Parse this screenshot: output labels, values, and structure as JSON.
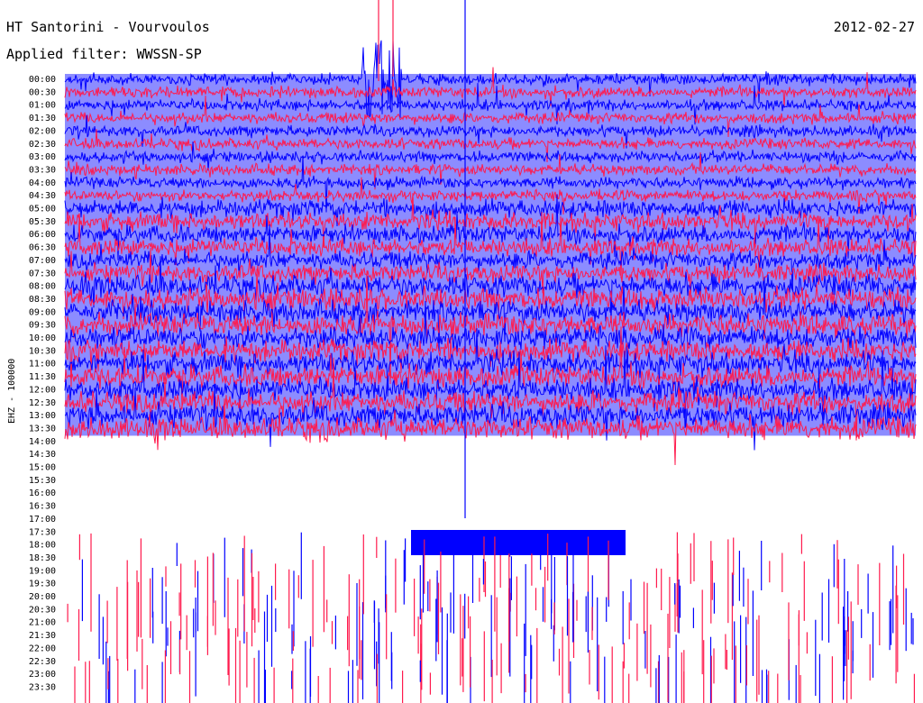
{
  "header": {
    "title": "HT Santorini - Vourvoulos",
    "date": "2012-02-27",
    "filter": "Applied filter: WWSSN-SP"
  },
  "chart_data": {
    "type": "line",
    "title": "HT Santorini - Vourvoulos",
    "subtitle": "Applied filter: WWSSN-SP",
    "ylabel": "EHZ - 100000",
    "xlabel": "",
    "tick_labels": [
      "00:00",
      "00:30",
      "01:00",
      "01:30",
      "02:00",
      "02:30",
      "03:00",
      "03:30",
      "04:00",
      "04:30",
      "05:00",
      "05:30",
      "06:00",
      "06:30",
      "07:00",
      "07:30",
      "08:00",
      "08:30",
      "09:00",
      "09:30",
      "10:00",
      "10:30",
      "11:00",
      "11:30",
      "12:00",
      "12:30",
      "13:00",
      "13:30",
      "14:00",
      "14:30",
      "15:00",
      "15:30",
      "16:00",
      "16:30",
      "17:00",
      "17:30",
      "18:00",
      "18:30",
      "19:00",
      "19:30",
      "20:00",
      "20:30",
      "21:00",
      "21:30",
      "22:00",
      "22:30",
      "23:00",
      "23:30"
    ],
    "series_colors": [
      "#0000ff",
      "#ff1a4d"
    ],
    "rows_with_trace": 28,
    "grid": false,
    "legend": "none"
  }
}
